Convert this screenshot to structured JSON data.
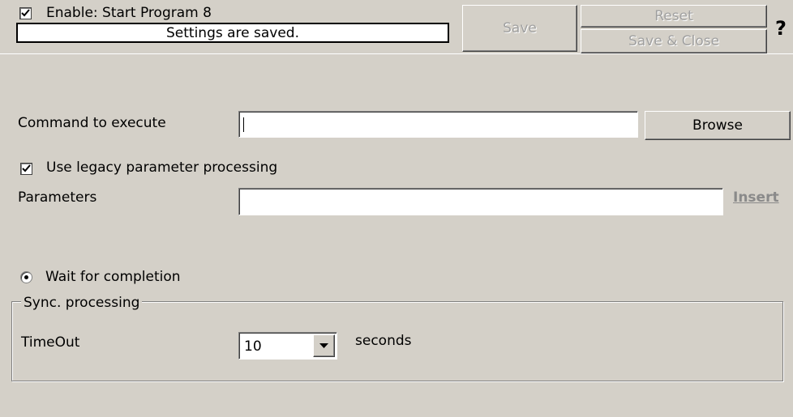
{
  "header": {
    "enable_checked": true,
    "enable_label": "Enable: Start Program 8",
    "status_message": "Settings are saved.",
    "save_label": "Save",
    "reset_label": "Reset",
    "save_close_label": "Save & Close",
    "help_label": "?"
  },
  "command": {
    "label": "Command to execute",
    "value": "",
    "browse_label": "Browse"
  },
  "legacy": {
    "checked": true,
    "label": "Use legacy parameter processing"
  },
  "parameters": {
    "label": "Parameters",
    "value": "",
    "insert_label": "Insert"
  },
  "wait": {
    "selected": true,
    "label": "Wait for completion"
  },
  "sync": {
    "group_title": "Sync. processing",
    "timeout_label": "TimeOut",
    "timeout_value": "10",
    "unit_label": "seconds"
  }
}
